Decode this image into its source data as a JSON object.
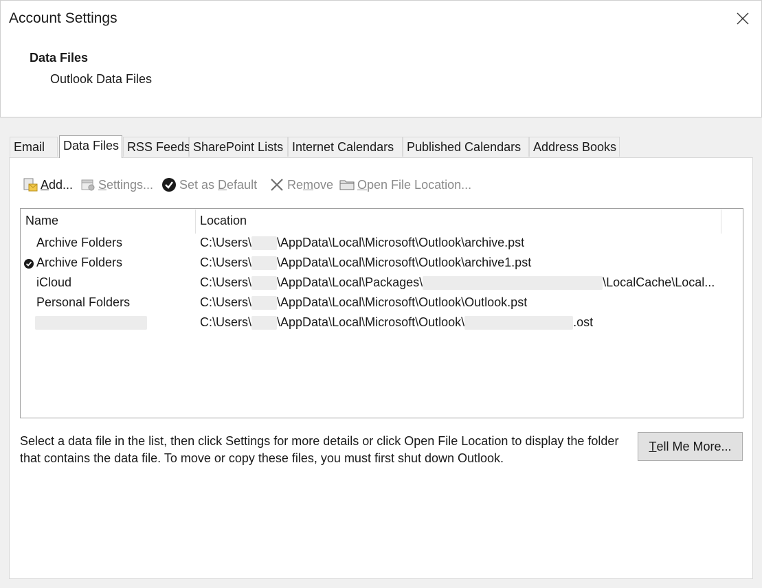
{
  "window": {
    "title": "Account Settings"
  },
  "header": {
    "title": "Data Files",
    "subtitle": "Outlook Data Files"
  },
  "tabs": [
    {
      "label": "Email",
      "active": false
    },
    {
      "label": "Data Files",
      "active": true
    },
    {
      "label": "RSS Feeds",
      "active": false
    },
    {
      "label": "SharePoint Lists",
      "active": false
    },
    {
      "label": "Internet Calendars",
      "active": false
    },
    {
      "label": "Published Calendars",
      "active": false
    },
    {
      "label": "Address Books",
      "active": false
    }
  ],
  "toolbar": {
    "add": {
      "mnemonic": "A",
      "rest": "dd...",
      "icon": "add-data-file-icon",
      "enabled": true
    },
    "settings": {
      "mnemonic": "S",
      "rest": "ettings...",
      "icon": "settings-icon",
      "enabled": false
    },
    "set_default": {
      "pre": "Set as ",
      "mnemonic": "D",
      "rest": "efault",
      "icon": "checkmark-icon",
      "enabled": false
    },
    "remove": {
      "pre": "Re",
      "mnemonic": "m",
      "rest": "ove",
      "icon": "remove-x-icon",
      "enabled": false
    },
    "open_location": {
      "mnemonic": "O",
      "rest": "pen File Location...",
      "icon": "folder-icon",
      "enabled": false
    }
  },
  "list": {
    "columns": [
      "Name",
      "Location"
    ],
    "rows": [
      {
        "name": "Archive Folders",
        "default": false,
        "loc_prefix": "C:\\Users\\",
        "loc_suffix": "\\AppData\\Local\\Microsoft\\Outlook\\archive.pst"
      },
      {
        "name": "Archive Folders",
        "default": true,
        "loc_prefix": "C:\\Users\\",
        "loc_suffix": "\\AppData\\Local\\Microsoft\\Outlook\\archive1.pst"
      },
      {
        "name": "iCloud",
        "default": false,
        "loc_prefix": "C:\\Users\\",
        "loc_middle": "\\AppData\\Local\\Packages\\",
        "loc_suffix": "\\LocalCache\\Local..."
      },
      {
        "name": "Personal Folders",
        "default": false,
        "loc_prefix": "C:\\Users\\",
        "loc_suffix": "\\AppData\\Local\\Microsoft\\Outlook\\Outlook.pst"
      },
      {
        "name": "",
        "default": false,
        "loc_prefix": "C:\\Users\\",
        "loc_middle": "\\AppData\\Local\\Microsoft\\Outlook\\",
        "loc_suffix": ".ost"
      }
    ]
  },
  "help_text": "Select a data file in the list, then click Settings for more details or click Open File Location to display the folder that contains the data file. To move or copy these files, you must first shut down Outlook.",
  "tell_me_more": {
    "mnemonic": "T",
    "rest": "ell Me More..."
  }
}
